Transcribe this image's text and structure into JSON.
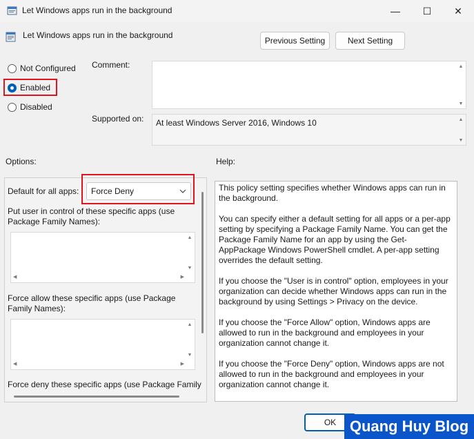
{
  "window": {
    "title": "Let Windows apps run in the background",
    "minimize_glyph": "—",
    "maximize_glyph": "☐",
    "close_glyph": "✕"
  },
  "header": {
    "policy_name": "Let Windows apps run in the background",
    "previous_label": "Previous Setting",
    "next_label": "Next Setting"
  },
  "state": {
    "options": [
      "Not Configured",
      "Enabled",
      "Disabled"
    ],
    "selected": "Enabled"
  },
  "comment": {
    "label": "Comment:",
    "value": ""
  },
  "supported": {
    "label": "Supported on:",
    "value": "At least Windows Server 2016, Windows 10"
  },
  "options_panel": {
    "label": "Options:",
    "default_label": "Default for all apps:",
    "default_value": "Force Deny",
    "user_control_label": "Put user in control of these specific apps (use Package Family Names):",
    "force_allow_label": "Force allow these specific apps (use Package Family Names):",
    "force_deny_label": "Force deny these specific apps (use Package Family"
  },
  "help_panel": {
    "label": "Help:",
    "paragraphs": [
      "This policy setting specifies whether Windows apps can run in the background.",
      "You can specify either a default setting for all apps or a per-app setting by specifying a Package Family Name. You can get the Package Family Name for an app by using the Get-AppPackage Windows PowerShell cmdlet. A per-app setting overrides the default setting.",
      "If you choose the \"User is in control\" option, employees in your organization can decide whether Windows apps can run in the background by using Settings > Privacy on the device.",
      "If you choose the \"Force Allow\" option, Windows apps are allowed to run in the background and employees in your organization cannot change it.",
      "If you choose the \"Force Deny\" option, Windows apps are not allowed to run in the background and employees in your organization cannot change it."
    ]
  },
  "footer": {
    "ok_label": "OK"
  },
  "watermark": "Quang Huy Blog",
  "colors": {
    "accent": "#005fb8",
    "highlight": "#e0141e",
    "watermark_bg": "#0a55c9"
  }
}
